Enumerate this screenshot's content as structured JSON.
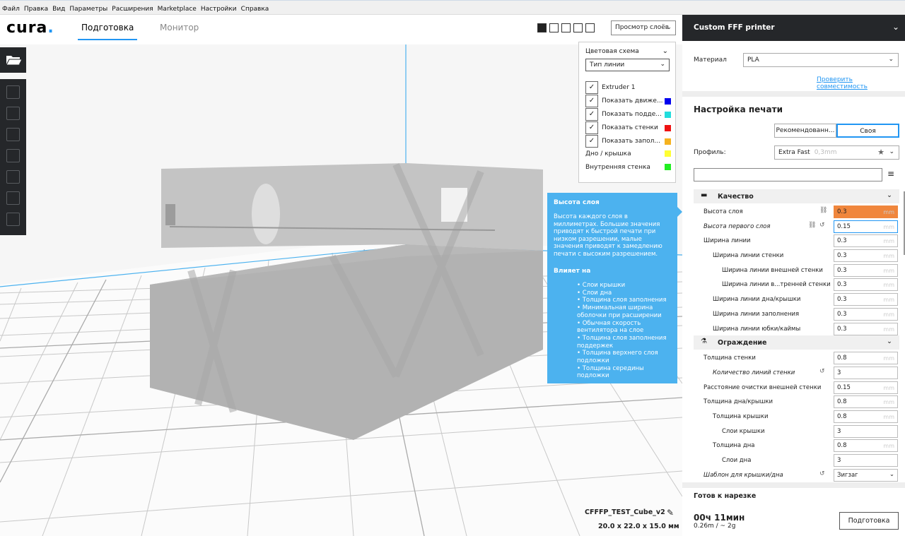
{
  "menubar": {
    "items": [
      "Файл",
      "Правка",
      "Вид",
      "Параметры",
      "Расширения",
      "Marketplace",
      "Настройки",
      "Справка"
    ]
  },
  "header": {
    "logo": "cura",
    "logo_dot": ".",
    "tabs": [
      {
        "label": "Подготовка",
        "active": true
      },
      {
        "label": "Монитор",
        "active": false
      }
    ],
    "view_mode": "Просмотр слоёв",
    "view_icons": [
      "3d-view-icon",
      "front-view-icon",
      "top-view-icon",
      "left-view-icon",
      "right-view-icon"
    ]
  },
  "left_toolbar": {
    "tools": [
      "open-file-icon",
      "move-tool-icon",
      "scale-tool-icon",
      "rotate-tool-icon",
      "mirror-tool-icon",
      "per-model-settings-icon",
      "support-blocker-icon"
    ]
  },
  "color_panel": {
    "title": "Цветовая схема",
    "scheme": "Тип линии",
    "items": [
      {
        "label": "Extruder 1",
        "checked": true,
        "color": ""
      },
      {
        "label": "Показать движе...",
        "checked": true,
        "color": "#0000ee"
      },
      {
        "label": "Показать подде...",
        "checked": true,
        "color": "#22dddd"
      },
      {
        "label": "Показать стенки",
        "checked": true,
        "color": "#ee1111"
      },
      {
        "label": "Показать запол...",
        "checked": true,
        "color": "#f5b21f"
      }
    ],
    "legend": [
      {
        "label": "Дно / крышка",
        "color": "#ffff33"
      },
      {
        "label": "Внутренняя стенка",
        "color": "#22ee22"
      }
    ]
  },
  "tooltip": {
    "title": "Высота слоя",
    "body": "Высота каждого слоя в миллиметрах. Большие значения приводят к быстрой печати при низком разрешении, малые значения приводят к замедлению печати с высоким разрешением.",
    "affects_title": "Влияет на",
    "affects": [
      "Слои крышки",
      "Слои дна",
      "Толщина слоя заполнения",
      "Минимальная ширина оболочки при расширении",
      "Обычная скорость вентилятора на слое",
      "Толщина слоя заполнения поддержек",
      "Толщина верхнего слоя подложки",
      "Толщина середины подложки"
    ]
  },
  "object": {
    "name": "CFFFP_TEST_Cube_v2",
    "dimensions": "20.0 x 22.0 x 15.0 мм"
  },
  "right_panel": {
    "printer": "Custom FFF printer",
    "material_label": "Материал",
    "material": "PLA",
    "compat_link": "Проверить совместимость",
    "print_settings_title": "Настройка печати",
    "mode_recommended": "Рекомендованн...",
    "mode_custom": "Своя",
    "profile_label": "Профиль:",
    "profile": "Extra Fast",
    "profile_sub": "0,3mm",
    "search_placeholder": ""
  },
  "settings": {
    "quality_title": "Качество",
    "shell_title": "Ограждение",
    "quality": [
      {
        "label": "Высота слоя",
        "value": "0.3",
        "unit": "mm"
      },
      {
        "label": "Высота первого слоя",
        "value": "0.15",
        "unit": "mm"
      },
      {
        "label": "Ширина линии",
        "value": "0.3",
        "unit": "mm"
      },
      {
        "label": "Ширина линии стенки",
        "value": "0.3",
        "unit": "mm"
      },
      {
        "label": "Ширина линии внешней стенки",
        "value": "0.3",
        "unit": "mm"
      },
      {
        "label": "Ширина линии в...тренней стенки",
        "value": "0.3",
        "unit": "mm"
      },
      {
        "label": "Ширина линии дна/крышки",
        "value": "0.3",
        "unit": "mm"
      },
      {
        "label": "Ширина линии заполнения",
        "value": "0.3",
        "unit": "mm"
      },
      {
        "label": "Ширина линии юбки/каймы",
        "value": "0.3",
        "unit": "mm"
      }
    ],
    "shell": [
      {
        "label": "Толщина стенки",
        "value": "0.8",
        "unit": "mm"
      },
      {
        "label": "Количество линий стенки",
        "value": "3",
        "unit": ""
      },
      {
        "label": "Расстояние очистки внешней стенки",
        "value": "0.15",
        "unit": "mm"
      },
      {
        "label": "Толщина дна/крышки",
        "value": "0.8",
        "unit": "mm"
      },
      {
        "label": "Толщина крышки",
        "value": "0.8",
        "unit": "mm"
      },
      {
        "label": "Слои крышки",
        "value": "3",
        "unit": ""
      },
      {
        "label": "Толщина дна",
        "value": "0.8",
        "unit": "mm"
      },
      {
        "label": "Слои дна",
        "value": "3",
        "unit": ""
      },
      {
        "label": "Шаблон для крышки/дна",
        "value": "Зигзаг",
        "unit": ""
      }
    ]
  },
  "footer": {
    "ready_label": "Готов к нарезке",
    "time": "00ч 11мин",
    "material_usage": "0.26m / ~ 2g",
    "slice_button": "Подготовка"
  }
}
